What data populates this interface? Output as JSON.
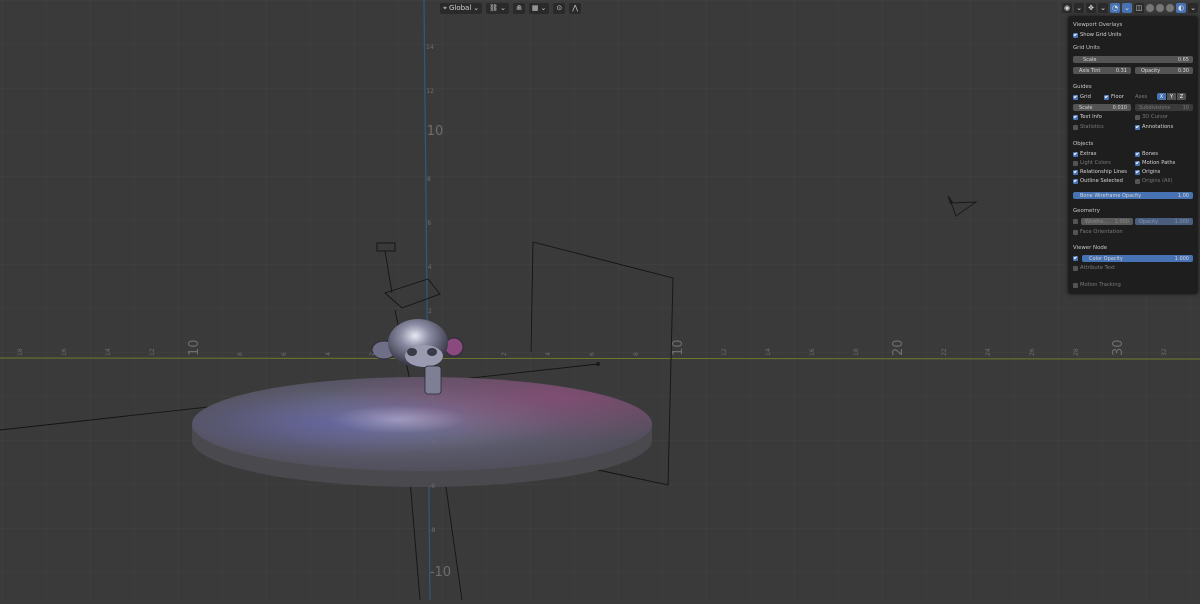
{
  "header": {
    "transform_orientation": "Global"
  },
  "viewport": {
    "y_axis_ticks": [
      "14",
      "12",
      "10",
      "8",
      "6",
      "4",
      "2",
      "-2",
      "-4",
      "-6",
      "-8",
      "-10"
    ],
    "x_axis_ticks": [
      "18",
      "16",
      "14",
      "12",
      "10",
      "8",
      "6",
      "4",
      "2",
      "2",
      "4",
      "6",
      "8",
      "10",
      "12",
      "14",
      "16",
      "18",
      "20",
      "22",
      "24",
      "26",
      "28",
      "30",
      "32",
      "34"
    ]
  },
  "overlays": {
    "title": "Viewport Overlays",
    "show_grid_units": "Show Grid Units",
    "grid_units": {
      "heading": "Grid Units",
      "scale_label": "Scale",
      "scale_value": "0.65",
      "axis_tint_label": "Axis Tint",
      "axis_tint_value": "0.31",
      "opacity_label": "Opacity",
      "opacity_value": "0.30"
    },
    "guides": {
      "heading": "Guides",
      "grid": "Grid",
      "floor": "Floor",
      "axes": "Axes",
      "x": "X",
      "y": "Y",
      "z": "Z",
      "scale_label": "Scale",
      "scale_value": "0.010",
      "subdivisions_label": "Subdivisions",
      "subdivisions_value": "10",
      "text_info": "Text Info",
      "cursor_3d": "3D Cursor",
      "statistics": "Statistics",
      "annotations": "Annotations"
    },
    "objects": {
      "heading": "Objects",
      "extras": "Extras",
      "bones": "Bones",
      "light_colors": "Light Colors",
      "motion_paths": "Motion Paths",
      "relationship_lines": "Relationship Lines",
      "origins": "Origins",
      "outline_selected": "Outline Selected",
      "origins_all": "Origins (All)",
      "bone_wireframe_label": "Bone Wireframe Opacity",
      "bone_wireframe_value": "1.00"
    },
    "geometry": {
      "heading": "Geometry",
      "wireframe_label": "Wirefra...",
      "wireframe_value": "1.000",
      "opacity_label": "Opacity",
      "opacity_value": "1.000",
      "face_orientation": "Face Orientation"
    },
    "viewer_node": {
      "heading": "Viewer Node",
      "color_opacity_label": "Color Opacity",
      "color_opacity_value": "1.000",
      "attribute_text": "Attribute Text"
    },
    "motion_tracking": "Motion Tracking"
  },
  "colors": {
    "accent": "#4772b3",
    "panel_bg": "#1e1e1e",
    "viewport_bg": "#3a3a3a",
    "x_axis": "#7e8a2a",
    "y_axis": "#2e5f8a"
  }
}
